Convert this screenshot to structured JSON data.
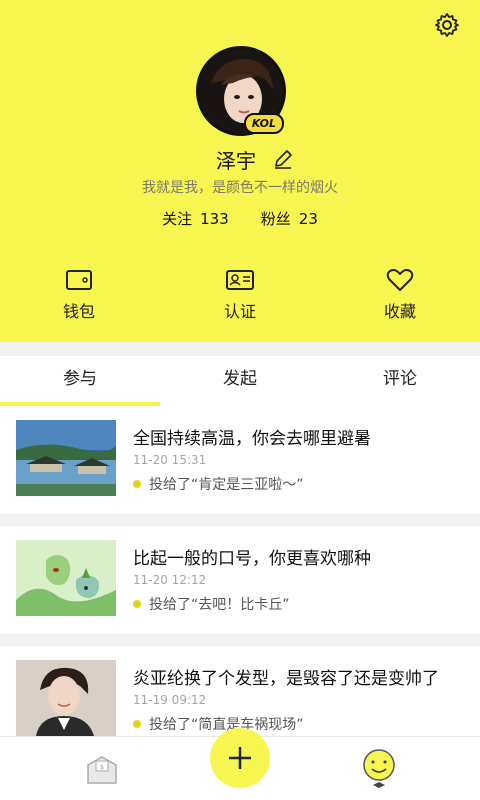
{
  "profile": {
    "name": "泽宇",
    "bio": "我就是我，是颜色不一样的烟火",
    "badge": "KOL",
    "following_label": "关注",
    "following_count": "133",
    "fans_label": "粉丝",
    "fans_count": "23"
  },
  "quick_actions": [
    {
      "label": "钱包",
      "icon": "wallet-icon"
    },
    {
      "label": "认证",
      "icon": "id-card-icon"
    },
    {
      "label": "收藏",
      "icon": "heart-icon"
    }
  ],
  "tabs": [
    {
      "label": "参与",
      "active": true
    },
    {
      "label": "发起",
      "active": false
    },
    {
      "label": "评论",
      "active": false
    }
  ],
  "feed": [
    {
      "title": "全国持续高温，你会去哪里避暑",
      "time": "11-20 15:31",
      "vote": "投给了“肯定是三亚啦～”"
    },
    {
      "title": "比起一般的口号，你更喜欢哪种",
      "time": "11-20 12:12",
      "vote": "投给了“去吧！比卡丘”"
    },
    {
      "title": "炎亚纶换了个发型，是毁容了还是变帅了",
      "time": "11-19 09:12",
      "vote": "投给了“简直是车祸现场”"
    }
  ],
  "colors": {
    "accent": "#f7f54f",
    "dot": "#e5d21e"
  }
}
